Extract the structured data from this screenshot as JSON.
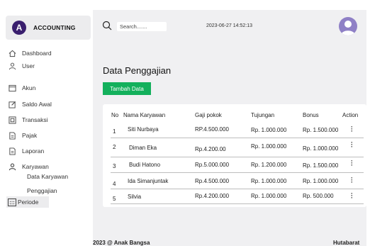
{
  "sidebar": {
    "brand_initial": "A",
    "brand_name": "ACCOUNTING",
    "items": [
      {
        "label": "Dashboard",
        "icon": "home-icon"
      },
      {
        "label": "User",
        "icon": "user-icon"
      },
      {
        "label": "Akun",
        "icon": "window-icon"
      },
      {
        "label": "Saldo Awal",
        "icon": "edit-icon"
      },
      {
        "label": "Transaksi",
        "icon": "transaction-icon"
      },
      {
        "label": "Pajak",
        "icon": "document-icon"
      },
      {
        "label": "Laporan",
        "icon": "document-icon"
      },
      {
        "label": "Karyawan",
        "icon": "user-icon"
      }
    ],
    "sub_items": [
      "Data Karyawan",
      "Penggajian"
    ],
    "periode": {
      "label": "Periode",
      "icon": "calendar-icon"
    }
  },
  "header": {
    "search_placeholder": "Search.......",
    "datetime": "2023-06-27 14:52:13"
  },
  "main": {
    "title": "Data Penggajian",
    "add_button": "Tambah Data",
    "table": {
      "headers": [
        "No",
        "Nama Karyawan",
        "Gaji pokok",
        "Tujungan",
        "Bonus",
        "Action"
      ],
      "rows": [
        [
          "1",
          "Siti Nurbaya",
          "RP.4.500.000",
          "Rp. 1.000.000",
          "Rp. 1.500.000"
        ],
        [
          "2",
          "Diman Eka",
          "Rp.4.200.00",
          "Rp. 1.000.000",
          "Rp. 1.000.000"
        ],
        [
          "3",
          "Budi Hatono",
          "Rp.5.000.000",
          "Rp. 1.200.000",
          "Rp. 1.500.000"
        ],
        [
          "4",
          "Ida Simanjuntak",
          "Rp.4.500.000",
          "Rp. 1.000.000",
          "Rp. 1.000.000"
        ],
        [
          "5",
          "Silvia",
          "Rp.4.200.000",
          "Rp. 1.000.000",
          "Rp. 500.000"
        ]
      ]
    }
  },
  "footer": {
    "left": "2023 @ Anak Bangsa",
    "right": "Hutabarat"
  },
  "colors": {
    "accent_green": "#13b05c",
    "brand_purple": "#3a1f6e",
    "avatar_purple": "#8f80c6",
    "main_bg": "#f0f0f2"
  }
}
